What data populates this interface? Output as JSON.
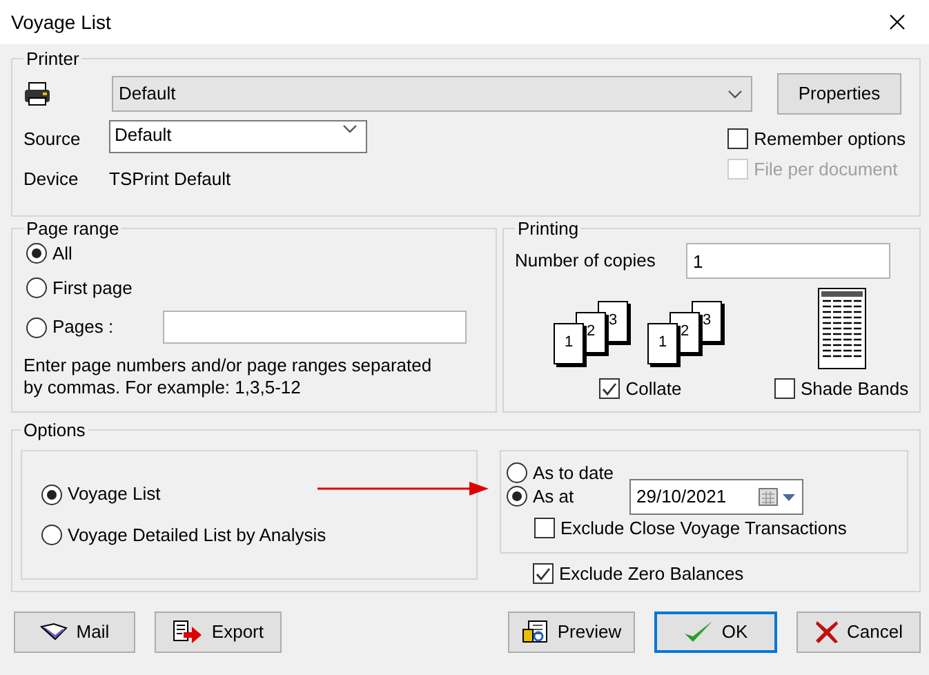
{
  "window": {
    "title": "Voyage List"
  },
  "printer": {
    "legend": "Printer",
    "printer_select": "Default",
    "properties_button": "Properties",
    "source_label": "Source",
    "source_select": "Default",
    "device_label": "Device",
    "device_value": "TSPrint Default",
    "options": [
      {
        "label": "Remember options",
        "checked": false,
        "disabled": false
      },
      {
        "label": "File per document",
        "checked": false,
        "disabled": true
      }
    ]
  },
  "page_range": {
    "legend": "Page range",
    "choices": [
      {
        "label": "All",
        "selected": true,
        "kind": "plain"
      },
      {
        "label": "First page",
        "selected": false,
        "kind": "plain"
      },
      {
        "label": "Pages :",
        "selected": false,
        "kind": "field"
      }
    ],
    "hint": "Enter page numbers and/or page ranges separated by commas. For example: 1,3,5-12"
  },
  "printing": {
    "legend": "Printing",
    "copies_label": "Number of copies",
    "copies_value": "1",
    "collate_icons": [
      {
        "pages": [
          "1",
          "2",
          "3"
        ]
      },
      {
        "pages": [
          "1",
          "2",
          "3"
        ]
      }
    ],
    "collate": {
      "label": "Collate",
      "checked": true
    },
    "shade_bands": {
      "label": "Shade Bands",
      "checked": false
    }
  },
  "options": {
    "legend": "Options",
    "report_types": [
      {
        "label": "Voyage List",
        "selected": true
      },
      {
        "label": "Voyage Detailed List by Analysis",
        "selected": false
      }
    ],
    "date_modes": [
      {
        "label": "As to date",
        "selected": false
      },
      {
        "label": "As at",
        "selected": true
      }
    ],
    "date_value": "29/10/2021",
    "exclude": [
      {
        "label": "Exclude Close Voyage Transactions",
        "checked": false
      },
      {
        "label": "Exclude Zero Balances",
        "checked": true
      }
    ]
  },
  "buttons": [
    {
      "label": "Mail",
      "kind": "mail",
      "default": false
    },
    {
      "label": "Export",
      "kind": "export",
      "default": false
    },
    {
      "label": "Preview",
      "kind": "preview",
      "default": false
    },
    {
      "label": "OK",
      "kind": "ok",
      "default": true
    },
    {
      "label": "Cancel",
      "kind": "cancel",
      "default": false
    }
  ]
}
